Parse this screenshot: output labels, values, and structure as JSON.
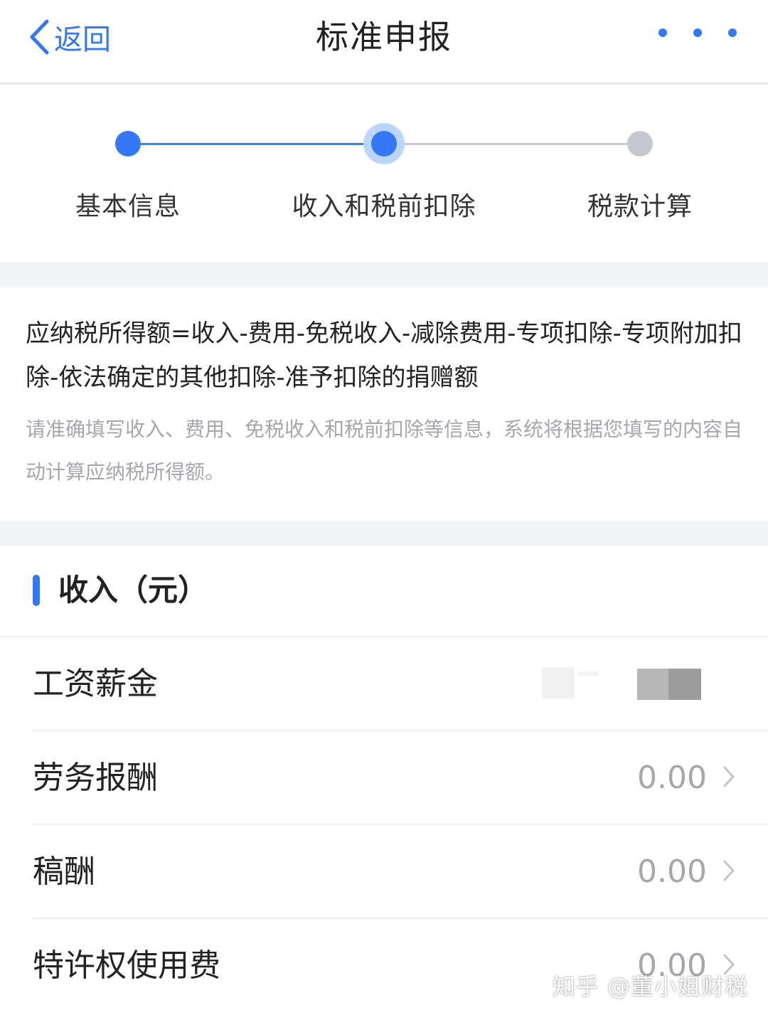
{
  "navbar": {
    "back_label": "返回",
    "title": "标准申报",
    "back_icon": "chevron-left-icon",
    "more_icon": "more-dots-icon",
    "accent_color": "#3478f6"
  },
  "stepper": {
    "steps": [
      {
        "label": "基本信息",
        "status": "done"
      },
      {
        "label": "收入和税前扣除",
        "status": "current"
      },
      {
        "label": "税款计算",
        "status": "pending"
      }
    ]
  },
  "info": {
    "formula": "应纳税所得额=收入-费用-免税收入-减除费用-专项扣除-专项附加扣除-依法确定的其他扣除-准予扣除的捐赠额",
    "hint": "请准确填写收入、费用、免税收入和税前扣除等信息，系统将根据您填写的内容自动计算应纳税所得额。"
  },
  "income": {
    "title": "收入（元）",
    "rows": [
      {
        "label": "工资薪金",
        "value": ""
      },
      {
        "label": "劳务报酬",
        "value": "0.00"
      },
      {
        "label": "稿酬",
        "value": "0.00"
      },
      {
        "label": "特许权使用费",
        "value": "0.00"
      }
    ],
    "row_icon": "chevron-right-icon"
  },
  "watermark": "知乎 @董小姐财税"
}
